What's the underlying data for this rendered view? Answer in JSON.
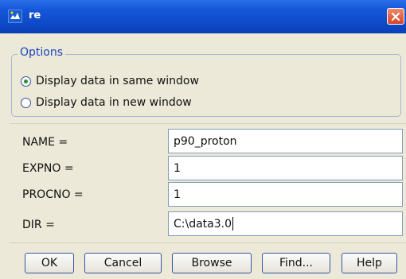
{
  "window": {
    "title": "re"
  },
  "options": {
    "legend": "Options",
    "radios": [
      {
        "label": "Display data in same window",
        "selected": true
      },
      {
        "label": "Display data in new window",
        "selected": false
      }
    ]
  },
  "params": [
    {
      "label": "NAME =",
      "value": "p90_proton"
    },
    {
      "label": "EXPNO =",
      "value": "1"
    },
    {
      "label": "PROCNO =",
      "value": "1"
    },
    {
      "label": "DIR =",
      "value": "C:\\data3.0"
    }
  ],
  "buttons": {
    "ok": "OK",
    "cancel": "Cancel",
    "browse": "Browse",
    "find": "Find...",
    "help": "Help"
  },
  "colors": {
    "titlebar": "#0f4ac8",
    "legend": "#1a44c0",
    "close": "#d8432a"
  },
  "icons": {
    "title": "app-icon",
    "close": "close-icon"
  }
}
